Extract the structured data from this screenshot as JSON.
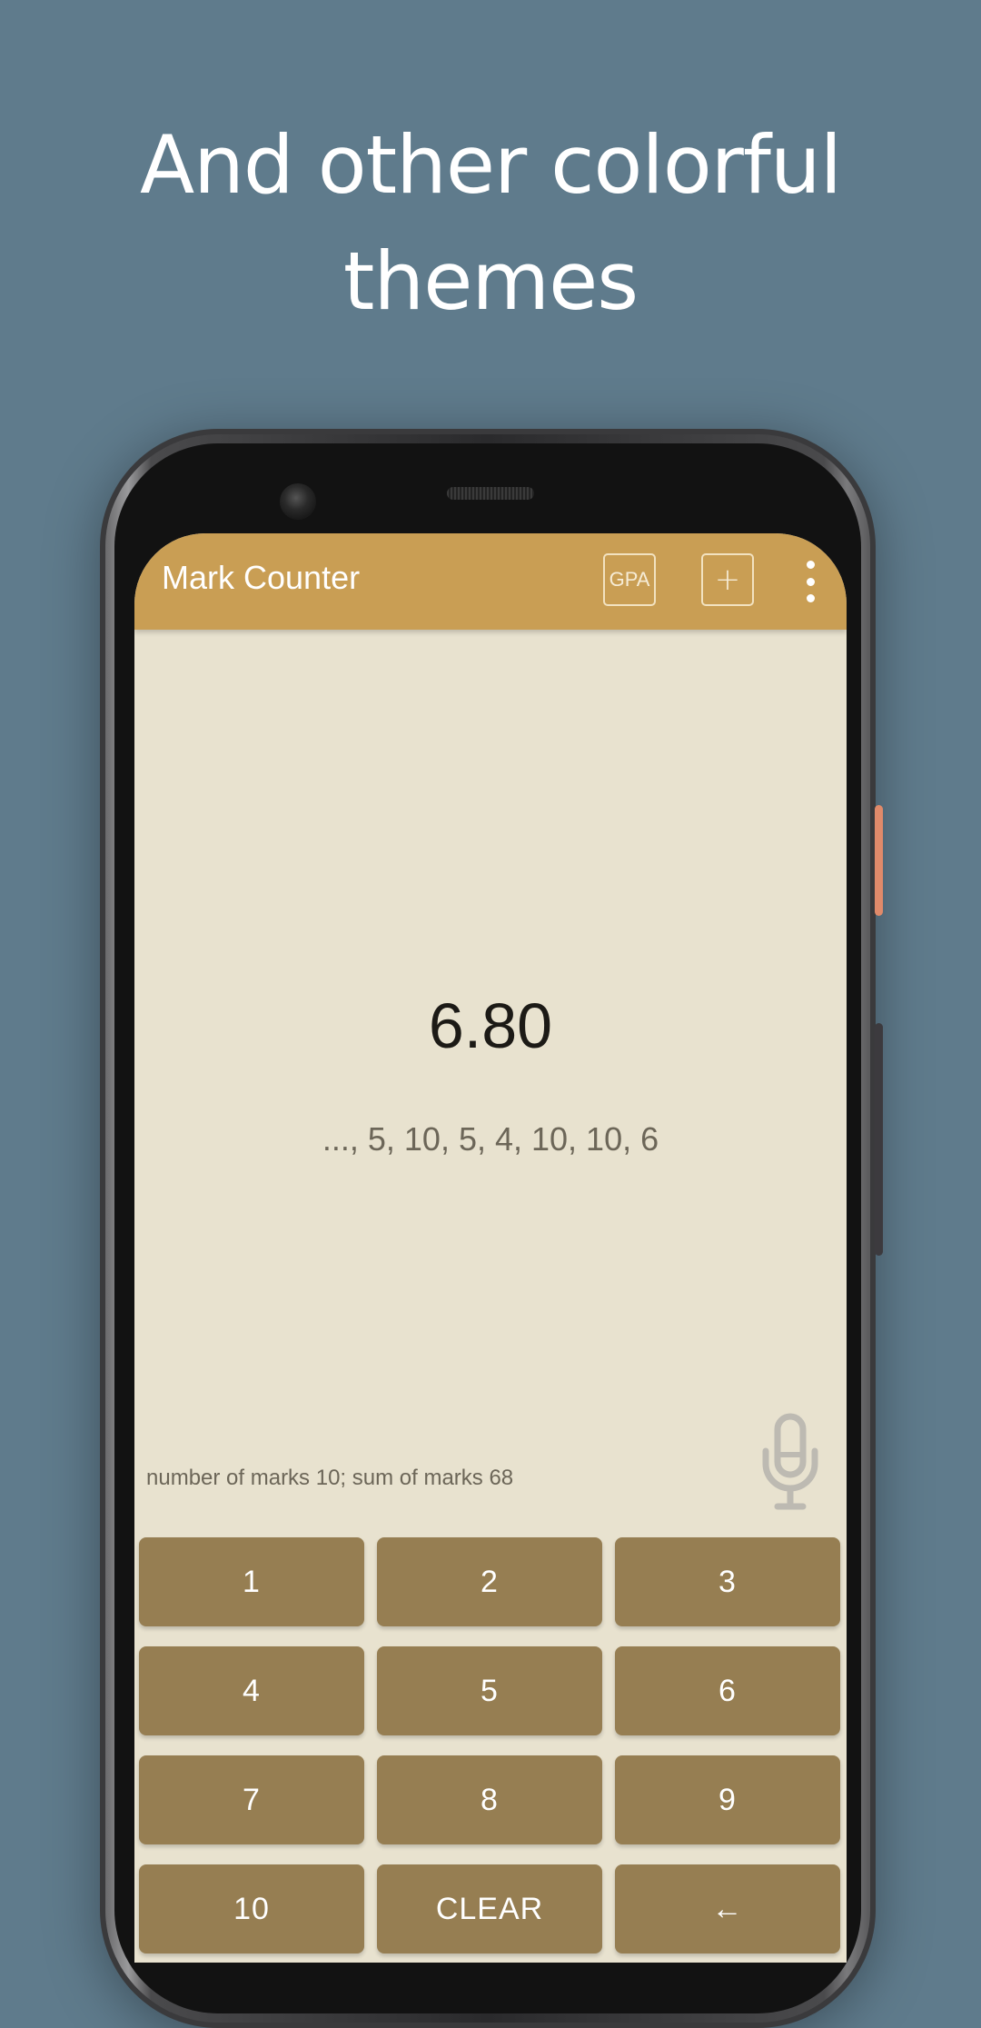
{
  "promo": {
    "headline_line1": "And other colorful",
    "headline_line2": "themes"
  },
  "theme": {
    "background": "#5f7b8c",
    "appbar": "#c99e54",
    "screen": "#e8e2cf",
    "key": "#967e52",
    "power_button": "#e08a6a"
  },
  "appbar": {
    "title": "Mark Counter",
    "gpa_label": "GPA",
    "add_label": "+",
    "more_icon": "more-vert-icon"
  },
  "main": {
    "average": "6.80",
    "history": "..., 5, 10, 5, 4, 10, 10, 6",
    "stats": "number of marks 10;  sum of marks 68",
    "mic_icon": "microphone-icon"
  },
  "keypad": {
    "keys": [
      "1",
      "2",
      "3",
      "4",
      "5",
      "6",
      "7",
      "8",
      "9",
      "10",
      "CLEAR",
      "←"
    ]
  }
}
